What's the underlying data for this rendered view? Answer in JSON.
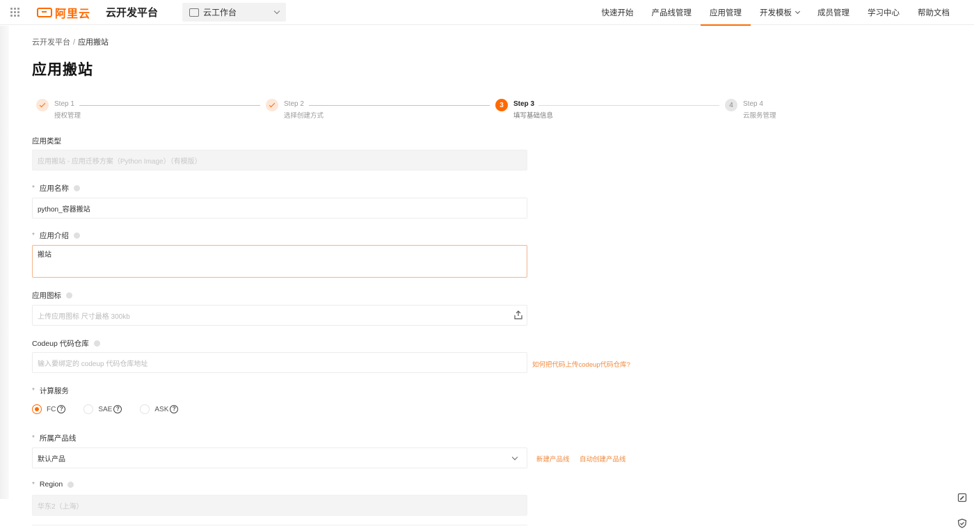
{
  "header": {
    "logo_text": "阿里云",
    "platform_name": "云开发平台",
    "workspace": "云工作台",
    "nav": [
      {
        "label": "快速开始"
      },
      {
        "label": "产品线管理"
      },
      {
        "label": "应用管理",
        "active": true
      },
      {
        "label": "开发模板"
      },
      {
        "label": "成员管理"
      },
      {
        "label": "学习中心"
      },
      {
        "label": "帮助文档"
      }
    ]
  },
  "breadcrumb": {
    "root": "云开发平台",
    "separator": "/",
    "current": "应用搬站"
  },
  "page_title": "应用搬站",
  "steps": [
    {
      "number": "1",
      "title": "Step 1",
      "subtitle": "授权管理",
      "status": "done"
    },
    {
      "number": "2",
      "title": "Step 2",
      "subtitle": "选择创建方式",
      "status": "done"
    },
    {
      "number": "3",
      "title": "Step 3",
      "subtitle": "填写基础信息",
      "status": "current"
    },
    {
      "number": "4",
      "title": "Step 4",
      "subtitle": "云服务管理",
      "status": "pending"
    }
  ],
  "form": {
    "app_type": {
      "label": "应用类型",
      "value": "应用搬站 - 应用迁移方案（Python Image）（有模版）"
    },
    "app_name": {
      "required_mark": "*",
      "label": "应用名称",
      "value": "python_容器搬站"
    },
    "app_intro": {
      "required_mark": "*",
      "label": "应用介绍",
      "value": "搬站"
    },
    "app_icon": {
      "label": "应用图标",
      "placeholder": "上传应用图标 尺寸最格 300kb"
    },
    "codeup": {
      "label": "Codeup 代码仓库",
      "placeholder": "输入要绑定的 codeup 代码仓库地址",
      "help_link": "如何把代码上传codeup代码仓库?"
    },
    "compute": {
      "required_mark": "*",
      "label": "计算服务",
      "options": [
        {
          "label": "FC",
          "checked": true
        },
        {
          "label": "SAE",
          "checked": false
        },
        {
          "label": "ASK",
          "checked": false
        }
      ],
      "help_glyph": "?"
    },
    "product_line": {
      "required_mark": "*",
      "label": "所属产品线",
      "value": "默认产品",
      "link_new": "新建产品线",
      "link_auto": "自动创建产品线"
    },
    "region": {
      "required_mark": "*",
      "label": "Region",
      "value": "华东2（上海）"
    }
  },
  "colors": {
    "accent": "#ff6a00",
    "link": "#f18a3e"
  }
}
